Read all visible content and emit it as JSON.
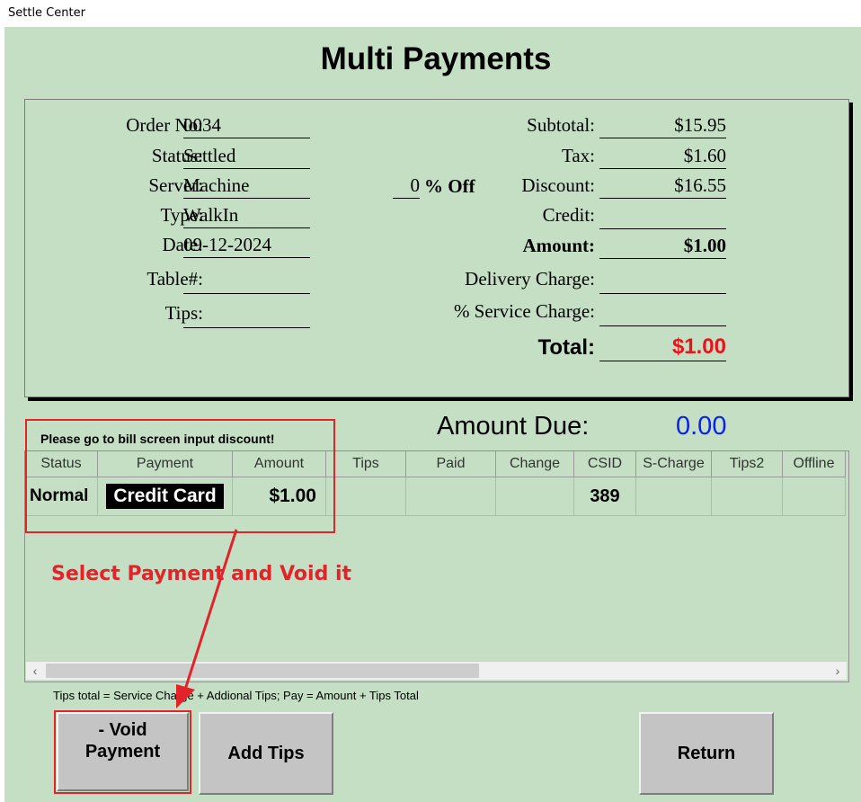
{
  "window": {
    "title": "Settle Center"
  },
  "page_title": "Multi Payments",
  "order": {
    "order_no_label": "Order No:",
    "order_no": "0034",
    "status_label": "Status:",
    "status": "Settled",
    "server_label": "Server:",
    "server": "Machine",
    "type_label": "Type:",
    "type": "WalkIn",
    "date_label": "Date:",
    "date": "09-12-2024",
    "table_label": "Table#:",
    "table": "",
    "tips_label": "Tips:",
    "tips": ""
  },
  "discount_pct": {
    "value": "0",
    "label": "% Off"
  },
  "totals": {
    "subtotal_label": "Subtotal:",
    "subtotal": "$15.95",
    "tax_label": "Tax:",
    "tax": "$1.60",
    "discount_label": "Discount:",
    "discount": "$16.55",
    "credit_label": "Credit:",
    "credit": "",
    "amount_label": "Amount:",
    "amount": "$1.00",
    "delivery_label": "Delivery Charge:",
    "delivery": "",
    "service_label": "% Service Charge:",
    "service": "",
    "total_label": "Total:",
    "total": "$1.00"
  },
  "amount_due": {
    "label": "Amount Due:",
    "value": "0.00"
  },
  "hint": "Please go to bill screen input discount!",
  "grid": {
    "columns": [
      "Status",
      "Payment",
      "Amount",
      "Tips",
      "Paid",
      "Change",
      "CSID",
      "S-Charge",
      "Tips2",
      "Offline"
    ],
    "rows": [
      {
        "status": "Normal",
        "payment": "Credit Card",
        "amount": "$1.00",
        "tips": "",
        "paid": "",
        "change": "",
        "csid": "389",
        "scharge": "",
        "tips2": "",
        "offline": ""
      }
    ]
  },
  "scroll": {
    "left_arrow": "‹",
    "right_arrow": "›"
  },
  "footnote": "Tips total = Service Charge + Addional Tips;  Pay = Amount + Tips Total",
  "buttons": {
    "void_line1": "- Void",
    "void_line2": "Payment",
    "add_tips": "Add Tips",
    "return": "Return"
  },
  "annotation": {
    "text": "Select Payment and Void it",
    "color": "#e2232a"
  },
  "colors": {
    "background": "#c4dfc4",
    "total_red": "#e8141a",
    "amount_due_blue": "#0b22e6"
  }
}
